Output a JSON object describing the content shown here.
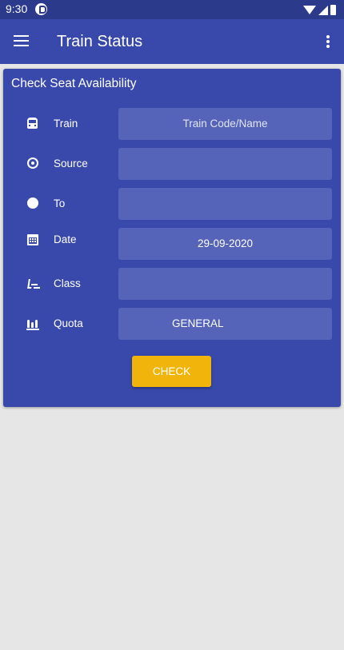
{
  "status_bar": {
    "time": "9:30"
  },
  "app_bar": {
    "title": "Train Status"
  },
  "card": {
    "title": "Check Seat Availability",
    "rows": [
      {
        "label": "Train",
        "value": "",
        "placeholder": "Train Code/Name",
        "icon": "train-icon"
      },
      {
        "label": "Source",
        "value": "",
        "placeholder": "",
        "icon": "radio-button-icon"
      },
      {
        "label": "To",
        "value": "",
        "placeholder": "",
        "icon": "destination-dot-icon"
      },
      {
        "label": "Date",
        "value": "29-09-2020",
        "placeholder": "",
        "icon": "calendar-icon"
      },
      {
        "label": "Class",
        "value": "",
        "placeholder": "",
        "icon": "seat-icon"
      },
      {
        "label": "Quota",
        "value": "GENERAL",
        "placeholder": "",
        "icon": "quota-icon"
      }
    ],
    "check_button": "CHECK"
  },
  "colors": {
    "primary": "#3949ab",
    "status_bar": "#2c3a8c",
    "field": "#5563b8",
    "accent": "#f0b40a",
    "background": "#e6e6e6"
  }
}
